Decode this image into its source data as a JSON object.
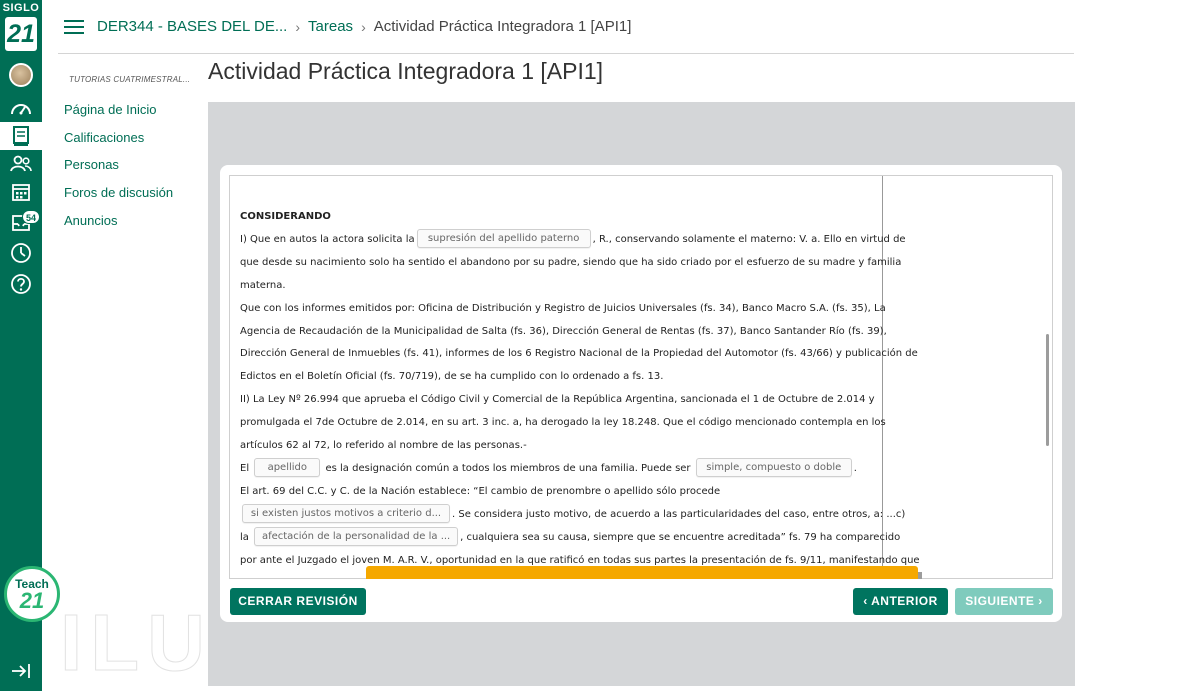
{
  "rail": {
    "logo_top": "SIGLO",
    "logo_number": "21",
    "badge_count": "54",
    "teach_label": "Teach",
    "teach_number": "21"
  },
  "breadcrumb": {
    "course": "DER344 - BASES DEL DE...",
    "section": "Tareas",
    "current": "Actividad Práctica Integradora 1 [API1]",
    "separator": "›"
  },
  "sidebar": {
    "course_label": "TUTORIAS CUATRIMESTRAL...",
    "items": [
      {
        "label": "Página de Inicio"
      },
      {
        "label": "Calificaciones"
      },
      {
        "label": "Personas"
      },
      {
        "label": "Foros de discusión"
      },
      {
        "label": "Anuncios"
      }
    ]
  },
  "page_title": "Actividad Práctica Integradora 1 [API1]",
  "document": {
    "heading": "CONSIDERANDO",
    "l1_a": "I) Que en autos la actora solicita la",
    "blank1": "supresión del apellido paterno",
    "l1_b": ", R., conservando solamente el materno: V. a. Ello en virtud de",
    "l2": "que desde su nacimiento solo ha sentido el abandono por su padre, siendo que ha sido criado por el esfuerzo de su madre y familia",
    "l3": "materna.",
    "l4": "Que con los informes emitidos por: Oficina de Distribución y Registro de Juicios Universales (fs. 34), Banco Macro S.A. (fs. 35), La",
    "l5": "Agencia de Recaudación de la Municipalidad de Salta (fs. 36), Dirección General de Rentas (fs. 37), Banco Santander Río (fs. 39),",
    "l6": "Dirección General de Inmuebles (fs. 41), informes de los 6 Registro Nacional de la Propiedad del Automotor (fs. 43/66) y publicación de",
    "l7": "Edictos en el Boletín Oficial (fs. 70/719), de se ha cumplido con lo ordenado a fs. 13.",
    "l8": "II) La Ley Nº 26.994 que aprueba el Código Civil y Comercial de la República Argentina, sancionada el 1 de Octubre de 2.014 y",
    "l9": "promulgada el 7de Octubre de 2.014, en su art. 3 inc. a, ha derogado la ley 18.248. Que el código mencionado contempla en los",
    "l10": "artículos 62 al 72, lo referido al nombre de las personas.-",
    "l11_a": "El",
    "blank2": "apellido",
    "l11_b": "es la designación común a todos los miembros de una familia. Puede ser",
    "blank3": "simple, compuesto o doble",
    "l11_c": ".",
    "l12": "El art. 69 del C.C. y C. de la Nación establece: “El cambio de prenombre o apellido sólo procede",
    "blank4": "si existen justos motivos a criterio d...",
    "l13_b": ". Se considera justo motivo, de acuerdo a las particularidades del caso, entre otros, a: ...c)",
    "l14_a": "la",
    "blank5": "afectación de la personalidad de la ...",
    "l14_b": ", cualquiera sea su causa, siempre que se encuentre acreditada” fs. 79 ha comparecido",
    "l15": "por ante el Juzgado el joven M. A.R. V., oportunidad en la que ratificó en todas sus partes la presentación de fs. 9/11, manifestando que"
  },
  "buttons": {
    "close_review": "CERRAR REVISIÓN",
    "previous": "ANTERIOR",
    "next": "SIGUIENTE"
  },
  "colors": {
    "brand": "#006e55",
    "accent_orange": "#f5a800",
    "button_disabled": "#7fcbbd"
  }
}
